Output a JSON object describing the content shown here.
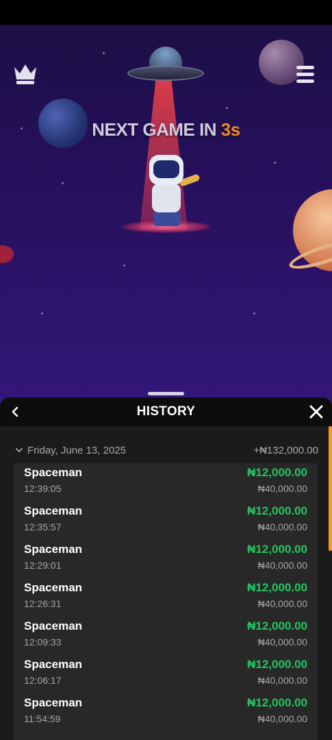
{
  "game": {
    "countdown_label": "NEXT GAME IN ",
    "countdown_value": "3s"
  },
  "history": {
    "title": "HISTORY",
    "date_label": "Friday, June 13, 2025",
    "date_total": "+₦132,000.00",
    "items": [
      {
        "name": "Spaceman",
        "time": "12:39:05",
        "win": "₦12,000.00",
        "bet": "₦40,000.00"
      },
      {
        "name": "Spaceman",
        "time": "12:35:57",
        "win": "₦12,000.00",
        "bet": "₦40,000.00"
      },
      {
        "name": "Spaceman",
        "time": "12:29:01",
        "win": "₦12,000.00",
        "bet": "₦40,000.00"
      },
      {
        "name": "Spaceman",
        "time": "12:26:31",
        "win": "₦12,000.00",
        "bet": "₦40,000.00"
      },
      {
        "name": "Spaceman",
        "time": "12:09:33",
        "win": "₦12,000.00",
        "bet": "₦40,000.00"
      },
      {
        "name": "Spaceman",
        "time": "12:06:17",
        "win": "₦12,000.00",
        "bet": "₦40,000.00"
      },
      {
        "name": "Spaceman",
        "time": "11:54:59",
        "win": "₦12,000.00",
        "bet": "₦40,000.00"
      }
    ]
  },
  "colors": {
    "accent": "#f08a1f",
    "win": "#22c55e",
    "scroll_thumb": "#f59a23"
  },
  "icons": {
    "crown": "crown-icon",
    "menu": "hamburger-menu-icon",
    "back": "chevron-left-icon",
    "close": "close-icon",
    "collapse": "chevron-down-icon"
  }
}
